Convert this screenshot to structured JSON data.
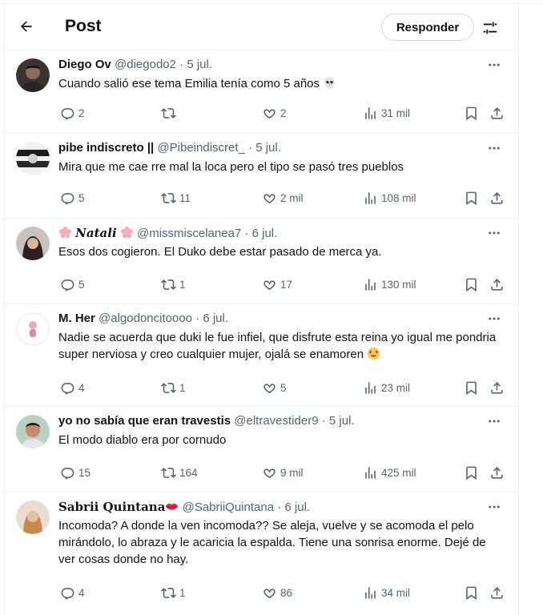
{
  "header": {
    "title": "Post",
    "reply_label": "Responder"
  },
  "icons": {
    "back": "arrow-left-icon",
    "settings": "sliders-icon",
    "more": "more-dots-icon",
    "reply": "reply-bubble-icon",
    "retweet": "retweet-icon",
    "like": "heart-icon",
    "views": "views-chart-icon",
    "bookmark": "bookmark-icon",
    "share": "share-icon"
  },
  "colors": {
    "secondary_text": "#536471",
    "border": "#eff3f4",
    "primary_text": "#0f1419"
  },
  "tweets": [
    {
      "author": "Diego Ov",
      "handle": "@diegodo2",
      "sep": "·",
      "date": "5 jul.",
      "text": "Cuando salió ese tema Emilia tenía como 5 años",
      "emoji": "skull",
      "replies": "2",
      "retweets": "",
      "likes": "2",
      "views": "31 mil"
    },
    {
      "author": "pibe indiscreto ||",
      "handle": "@Pibeindiscret_",
      "sep": "·",
      "date": "5 jul.",
      "text": "Mira que me cae rre mal la loca pero el tipo se pasó tres pueblos",
      "replies": "5",
      "retweets": "11",
      "likes": "2 mil",
      "views": "108 mil"
    },
    {
      "author": "𝑵𝒂𝒕𝒂𝒍𝒊",
      "handle": "@missmiscelanea7",
      "sep": "·",
      "date": "6 jul.",
      "text": "Esos dos cogieron. El Duko debe estar pasado de merca ya.",
      "replies": "5",
      "retweets": "1",
      "likes": "17",
      "views": "130 mil"
    },
    {
      "author": "M. Her",
      "handle": "@algodoncitoooo",
      "sep": "·",
      "date": "6 jul.",
      "text": "Nadie se acuerda que duki le fue infiel, que disfrute esta reina yo igual me pondria super nerviosa y creo cualquier mujer, ojalá se enamoren",
      "emoji": "heart-eyes",
      "replies": "4",
      "retweets": "1",
      "likes": "5",
      "views": "23 mil"
    },
    {
      "author": "yo no sabía que eran travestis",
      "handle": "@eltravestider9",
      "sep": "·",
      "date": "5 jul.",
      "text": "El modo diablo era por cornudo",
      "replies": "15",
      "retweets": "164",
      "likes": "9 mil",
      "views": "425 mil"
    },
    {
      "author": "𝐒𝐚𝐛𝐫𝐢𝐢 𝐐𝐮𝐢𝐧𝐭𝐚𝐧𝐚",
      "handle": "@SabriiQuintana",
      "sep": "·",
      "date": "6 jul.",
      "text": "Incomoda? A donde la ven incomoda?? Se aleja, vuelve y se acomoda el pelo mirándolo, lo abraza y le acaricia la espalda. Tiene una sonrisa enorme. Dejé de ver cosas  donde no hay.",
      "replies": "4",
      "retweets": "1",
      "likes": "86",
      "views": "34 mil"
    }
  ]
}
